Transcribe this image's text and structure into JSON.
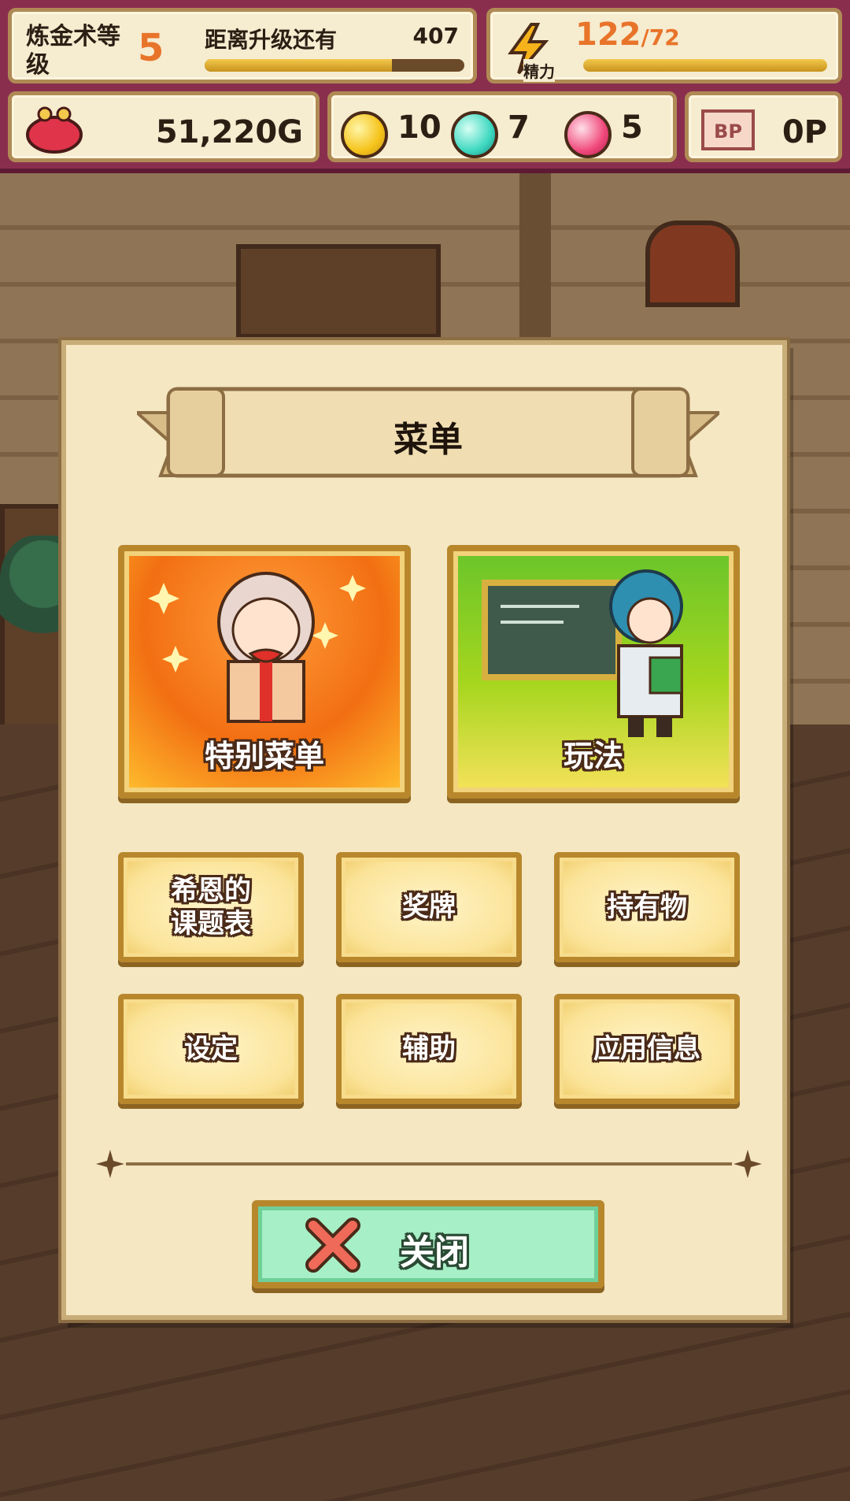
{
  "hud": {
    "alchemy_level_label": "炼金术等级",
    "alchemy_level": "5",
    "next_level_label": "距离升级还有",
    "next_level_remaining": "407",
    "next_level_progress": 0.72,
    "energy_label": "精力",
    "energy_current": "122",
    "energy_max": "/72",
    "energy_progress": 1.0,
    "money": "51,220G",
    "gems": [
      {
        "color": "yellow",
        "count": "10"
      },
      {
        "color": "teal",
        "count": "7"
      },
      {
        "color": "pink",
        "count": "5"
      }
    ],
    "bp_icon_text": "BP",
    "bp_value": "0P"
  },
  "menu": {
    "title": "菜单",
    "special_menu_label": "特别菜单",
    "how_to_play_label": "玩法",
    "small_buttons": [
      {
        "label": "希恩的\n课题表"
      },
      {
        "label": "奖牌"
      },
      {
        "label": "持有物"
      },
      {
        "label": "设定"
      },
      {
        "label": "辅助"
      },
      {
        "label": "应用信息"
      }
    ],
    "close_label": "关闭"
  },
  "colors": {
    "hud_bg": "#8a2e4e",
    "panel_bg": "#f4e7c2",
    "accent_orange": "#e8742a",
    "close_green": "#a7efc6",
    "gold_border": "#b8872c"
  }
}
